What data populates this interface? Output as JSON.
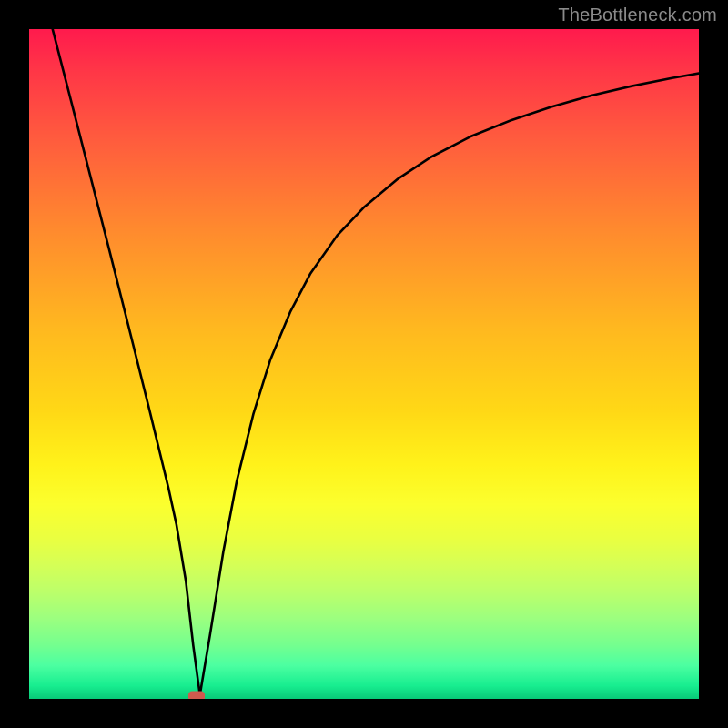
{
  "watermark": "TheBottleneck.com",
  "chart_data": {
    "type": "line",
    "title": "",
    "xlabel": "",
    "ylabel": "",
    "xlim": [
      0,
      100
    ],
    "ylim": [
      0,
      100
    ],
    "grid": false,
    "legend": false,
    "series": [
      {
        "name": "bottleneck-curve",
        "x": [
          3.5,
          6,
          9,
          12,
          15,
          18,
          20.8,
          22,
          23.4,
          24.5,
          25.5,
          27,
          29,
          31,
          33.5,
          36,
          39,
          42,
          46,
          50,
          55,
          60,
          66,
          72,
          78,
          84,
          90,
          96,
          100
        ],
        "y": [
          100,
          90.3,
          78.6,
          66.9,
          55,
          43,
          31.5,
          26,
          17.6,
          8,
          0.6,
          9.5,
          22,
          32.5,
          42.6,
          50.6,
          57.8,
          63.5,
          69.2,
          73.4,
          77.6,
          80.9,
          84,
          86.4,
          88.4,
          90.1,
          91.5,
          92.7,
          93.4
        ]
      }
    ],
    "markers": [
      {
        "name": "min-marker",
        "x": 25.0,
        "y": 0.2,
        "shape": "rounded-rect",
        "color": "#cf5a4e"
      }
    ],
    "background_gradient": {
      "top": "#ff1a4d",
      "mid": "#ffe81a",
      "bottom": "#08c978"
    }
  }
}
